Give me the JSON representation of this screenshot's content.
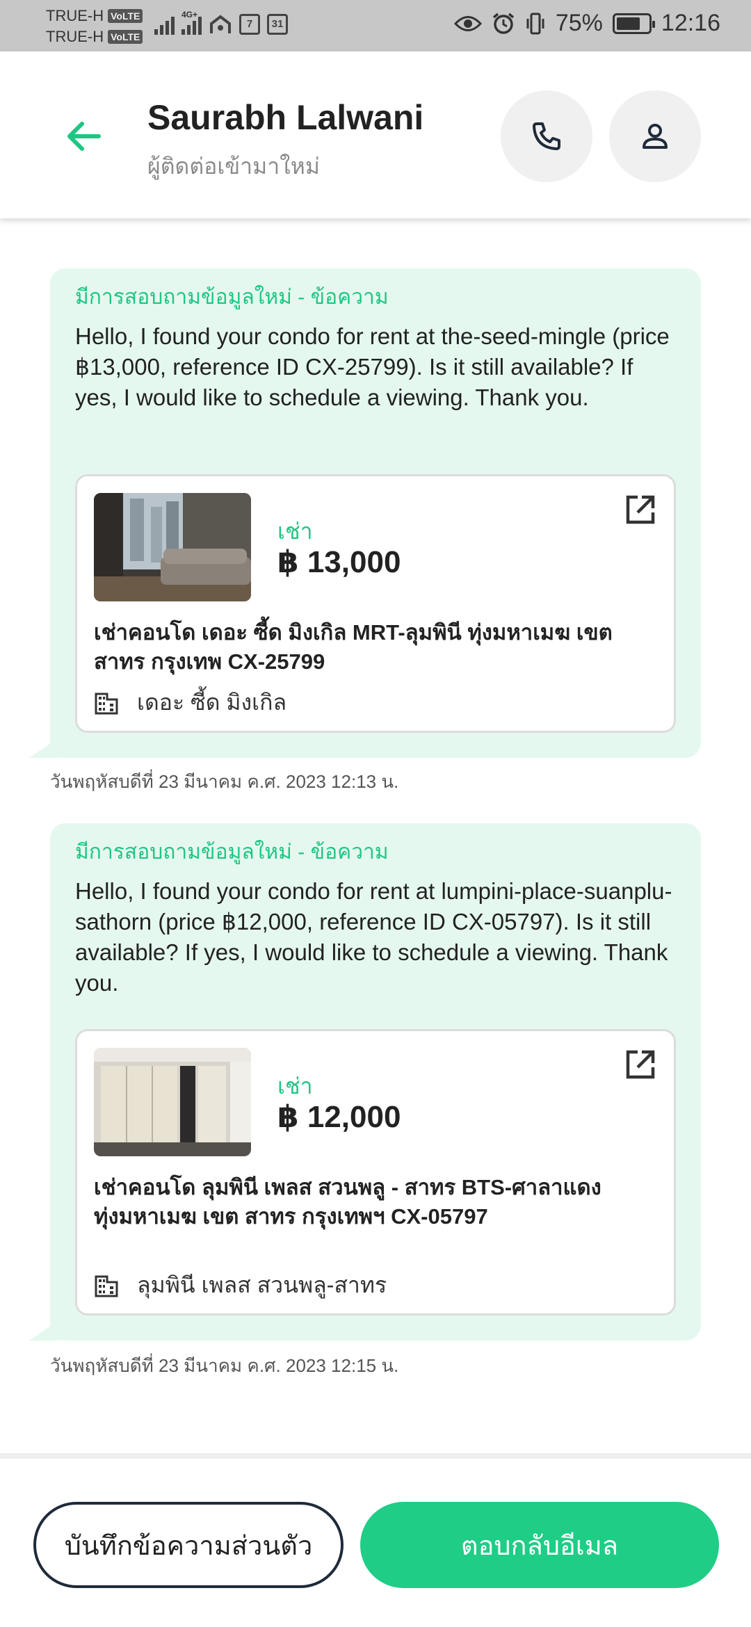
{
  "status_bar": {
    "carrier_1": "TRUE-H",
    "carrier_2": "TRUE-H",
    "volte": "VoLTE",
    "network": "4G+",
    "calendar_day": "31",
    "battery": "75%",
    "time": "12:16"
  },
  "header": {
    "contact_name": "Saurabh Lalwani",
    "contact_subtitle": "ผู้ติดต่อเข้ามาใหม่"
  },
  "messages": [
    {
      "title": "มีการสอบถามข้อมูลใหม่ - ข้อความ",
      "body": "Hello, I found your condo for rent at the-seed-mingle (price ฿13,000, reference ID CX-25799). Is it still available? If yes, I would like to schedule a viewing. Thank you.",
      "listing": {
        "type_label": "เช่า",
        "price": "฿ 13,000",
        "title": "เช่าคอนโด  เดอะ ซี้ด มิงเกิล MRT-ลุมพินี ทุ่งมหาเมฆ เขต สาทร กรุงเทพ CX-25799",
        "project": "เดอะ ซี้ด มิงเกิล"
      },
      "timestamp": "วันพฤหัสบดีที่ 23 มีนาคม ค.ศ. 2023 12:13 น."
    },
    {
      "title": "มีการสอบถามข้อมูลใหม่ - ข้อความ",
      "body": "Hello, I found your condo for rent at lumpini-place-suanplu-sathorn (price ฿12,000, reference ID CX-05797). Is it still available? If yes, I would like to schedule a viewing. Thank you.",
      "listing": {
        "type_label": "เช่า",
        "price": "฿ 12,000",
        "title": "เช่าคอนโด ลุมพินี เพลส สวนพลู - สาทร BTS-ศาลาแดง ทุ่งมหาเมฆ เขต สาทร กรุงเทพฯ CX-05797",
        "project": "ลุมพินี เพลส สวนพลู-สาทร"
      },
      "timestamp": "วันพฤหัสบดีที่ 23 มีนาคม ค.ศ. 2023 12:15 น."
    }
  ],
  "actions": {
    "private_note": "บันทึกข้อความส่วนตัว",
    "reply_email": "ตอบกลับอีเมล"
  },
  "colors": {
    "accent": "#1fcd86",
    "bubble": "#e5f8ef"
  }
}
